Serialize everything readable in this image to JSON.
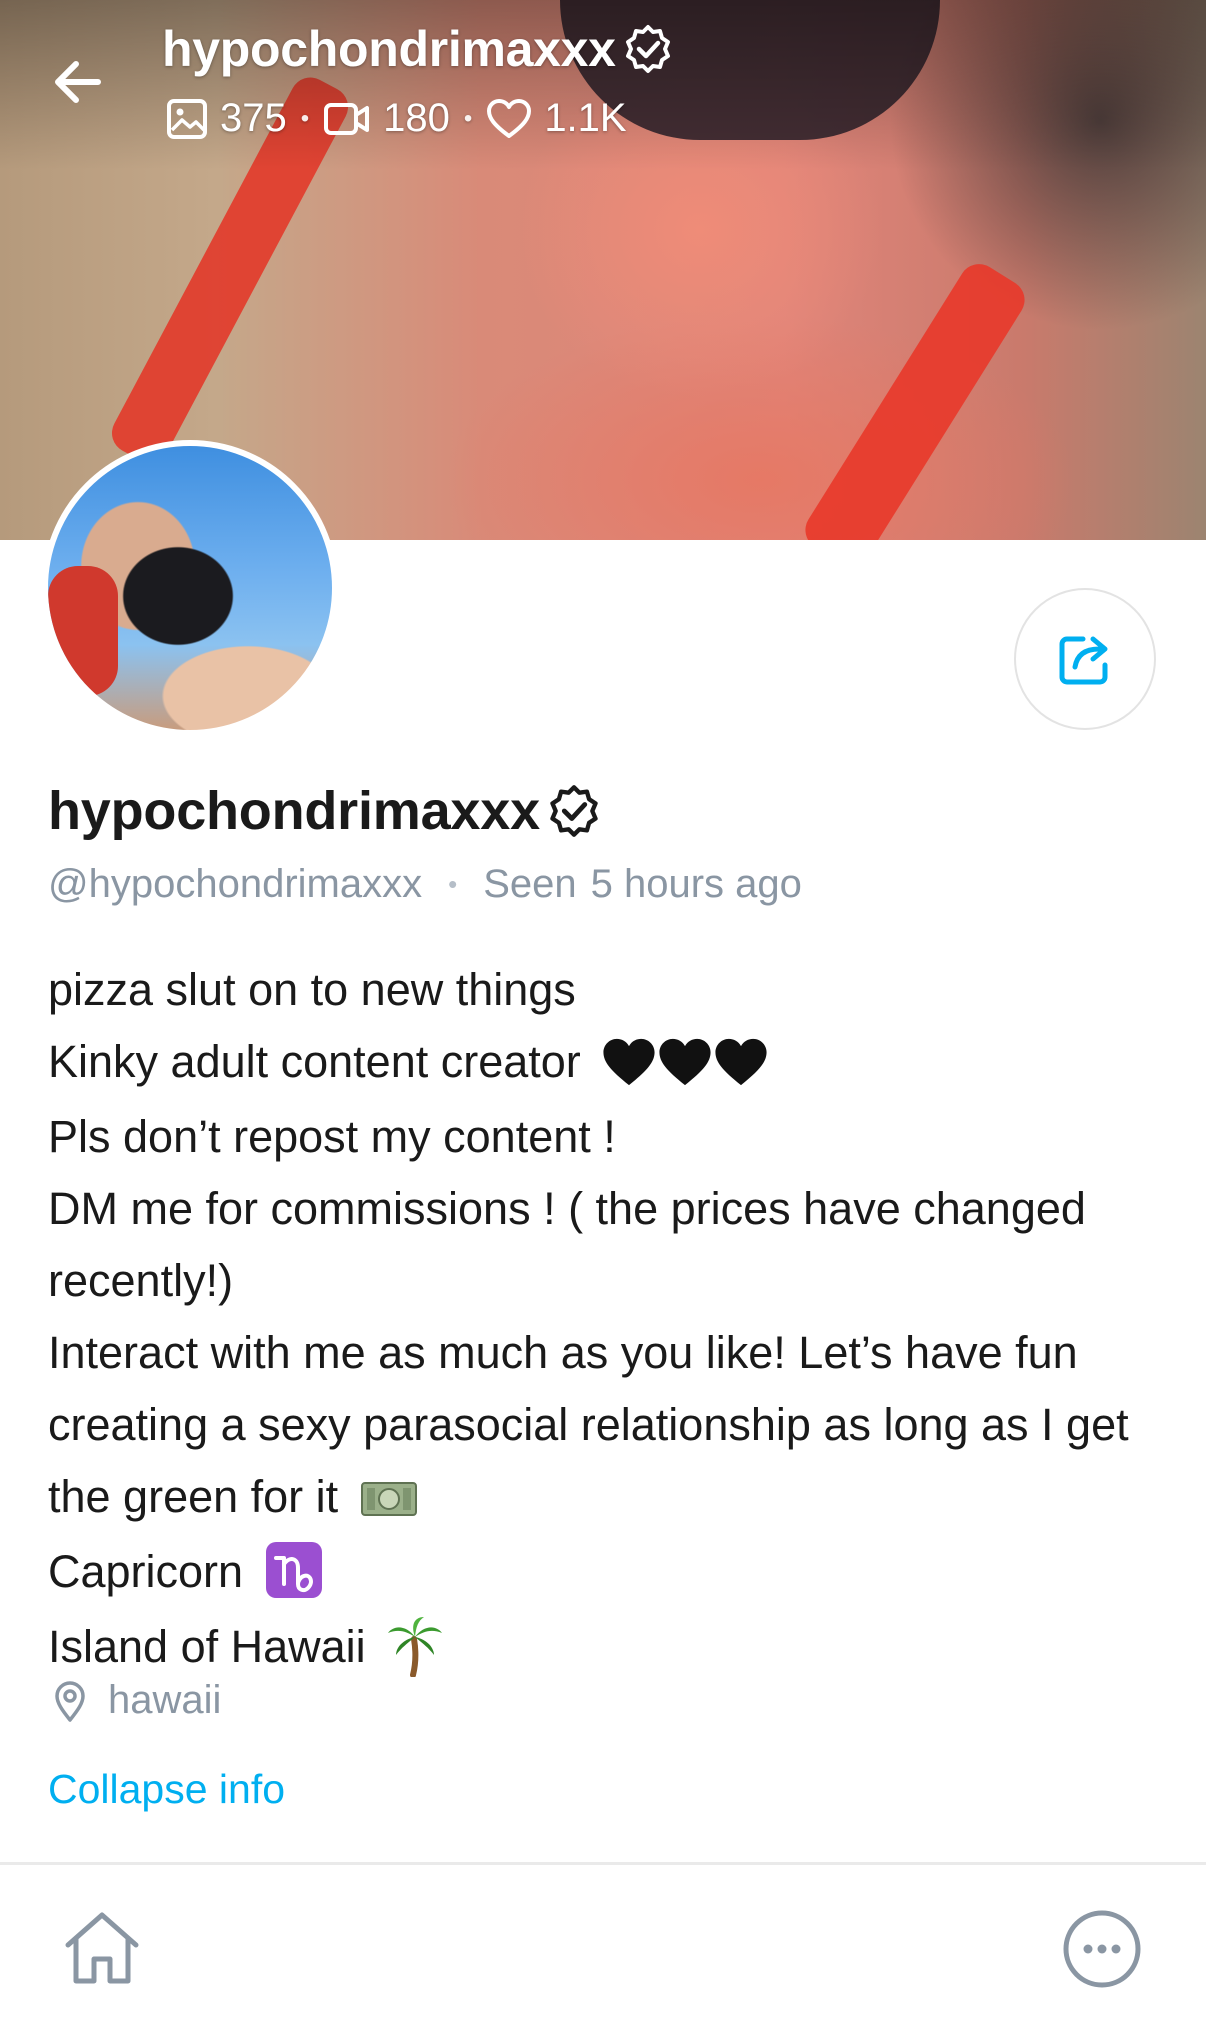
{
  "header": {
    "title": "hypochondrimaxxx",
    "stats": {
      "photos": "375",
      "videos": "180",
      "likes": "1.1K"
    },
    "icons": [
      "back-arrow-icon",
      "verified-icon",
      "image-icon",
      "video-icon",
      "heart-icon"
    ]
  },
  "profile": {
    "display_name": "hypochondrimaxxx",
    "handle": "@hypochondrimaxxx",
    "seen_label": "Seen",
    "seen_time": "5 hours ago",
    "bio_lines": [
      "pizza slut on to new things",
      "Kinky adult content creator",
      "Pls don’t repost my content !",
      "DM me for commissions ! ( the prices have changed recently!)",
      "Interact with me as much as you like! Let’s have fun creating a sexy parasocial relationship as long as I get the green for it",
      "Capricorn",
      "Island of Hawaii"
    ],
    "location": "hawaii",
    "collapse_label": "Collapse info"
  },
  "colors": {
    "accent": "#00aff0",
    "muted": "#8a96a3",
    "text": "#1a1a1a"
  },
  "bottom_nav": {
    "icons": [
      "home-icon",
      "more-icon"
    ]
  }
}
